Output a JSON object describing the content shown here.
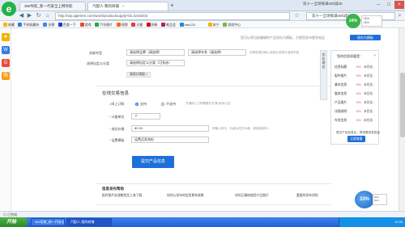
{
  "browser": {
    "tabs": [
      {
        "label": "360导航_新一代安全上网导航"
      },
      {
        "label": "汽配人-我的商铺"
      }
    ],
    "new_tab": "+",
    "site_link": "双十一全场每满400减30",
    "url": "http://vip.qipeiren.com/work/productsupply?id=4243202",
    "search": "双十一全场每满400减30"
  },
  "bookmarks": [
    {
      "label": "收藏",
      "color": "#f5b800"
    },
    {
      "label": "手机收藏夹",
      "color": "#2a7be4"
    },
    {
      "label": "谷歌",
      "color": "#4285f4"
    },
    {
      "label": "百度一下",
      "color": "#2932e1"
    },
    {
      "label": "游戏",
      "color": "#e44d26"
    },
    {
      "label": "汽车图片",
      "color": "#27a844"
    },
    {
      "label": "视频",
      "color": "#ff6a00"
    },
    {
      "label": "天猫",
      "color": "#e4393c"
    },
    {
      "label": "网易",
      "color": "#d00"
    },
    {
      "label": "唯品会",
      "color": "#c2185b"
    },
    {
      "label": "hao123",
      "color": "#1e88e5"
    },
    {
      "label": "苏宁",
      "color": "#f6b600"
    },
    {
      "label": "游戏中心",
      "color": "#7cb342"
    }
  ],
  "form": {
    "top_note": "您可以将当前编辑的产品保存为模板，方便您发布更多商品",
    "save_template": "保存为模板",
    "related_models_label": "关联车型",
    "brand_select": "请选择品牌（请选择）",
    "series_select": "请选择车系（请选择）",
    "related_hint": "关联前请先输入或者在选项中选择车型",
    "category_label": "选择自定义分类",
    "category_select": "请选择自定义分类（可多选）",
    "category_tag": "清洗分类配",
    "online_section": "在线交易信息",
    "online_label": "网上订购",
    "radio_yes": "支持",
    "radio_no": "不支持",
    "online_hint": "开通网上订购需要先开通“卖家认证”",
    "unit_label": "计量单位",
    "unit_value": "个",
    "price_label": "成交价格",
    "price_value": "82.00",
    "price_hint": "请输入数字，价格为成交价格，请谨慎填写。",
    "shipping_label": "运费模板",
    "shipping_value": "运费买家承担",
    "submit": "提交产品信息",
    "publish_section": "信息发布帮助",
    "help_links": [
      "配件图片处理教程及工具下载",
      "如何让发布的信息更有效果",
      "如何正确地使用产品图片",
      "重要的发布须知"
    ]
  },
  "quality": {
    "sidetabs": "优化建议",
    "title": "您的信息质量是：",
    "close": "×",
    "rows": [
      {
        "name": "信息标题",
        "pct": "0%",
        "status": "未优化"
      },
      {
        "name": "配件图片",
        "pct": "0%",
        "status": "未优化"
      },
      {
        "name": "基本信息",
        "pct": "0%",
        "status": "未优化"
      },
      {
        "name": "服务信息",
        "pct": "0%",
        "status": "未优化"
      },
      {
        "name": "产品图片",
        "pct": "0%",
        "status": "未优化"
      },
      {
        "name": "详细说明",
        "pct": "0%",
        "status": "未优化"
      },
      {
        "name": "车型信息",
        "pct": "0%",
        "status": "未优化"
      }
    ],
    "footer": "提交产品信息后，再查看信息质量",
    "button": "立即查看"
  },
  "net_widget": {
    "percent": "24%",
    "up": "0K/s",
    "down": "0K/s"
  },
  "ball_widget": {
    "percent": "33%",
    "line1": "0K/s",
    "line2": "0K/s"
  },
  "statusbar": {
    "text": "◎ 已完成"
  },
  "taskbar": {
    "start": "开始",
    "items": [
      "360导航_新一代安全上网导航",
      "汽配人-我的商铺"
    ],
    "time": "10:35"
  }
}
